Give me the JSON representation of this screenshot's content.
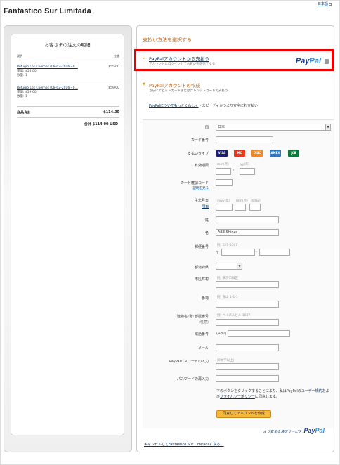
{
  "header": {
    "merchant": "Fantastico Sur Limitada",
    "language": "日本語"
  },
  "summary": {
    "title": "お客さまの注文の明細",
    "col_desc": "説明",
    "col_amount": "金額",
    "items": [
      {
        "name": "Refugio Los Cuernos (08-02-2016 - 0...",
        "amount": "$55.00",
        "price": "単価: $55.00",
        "qty": "数量: 1"
      },
      {
        "name": "Refugio Los Cuernos (08-02-2016 - 0...",
        "amount": "$59.00",
        "price": "単価: $59.00",
        "qty": "数量: 1"
      }
    ],
    "subtotal_label": "商品合計",
    "subtotal": "$114.00",
    "total": "合計 $114.00 USD"
  },
  "payment": {
    "select_title": "支払い方法を選択する",
    "paypal_option": "PayPalアカウントから支払う",
    "paypal_sub": "アカウントにログインしてお買い物を完了する",
    "create_title": "PayPalアカウントの作成",
    "create_sub": "さらにデビットカードまたはクレジットカードで支払う",
    "learn_link": "PayPalについてもっとくわしく",
    "learn_rest": " - スピーディかつより安全にお支払い"
  },
  "form": {
    "country_label": "国",
    "country_value": "日本",
    "card_label": "カード番号",
    "type_label": "支払いタイプ",
    "cards": [
      "VISA",
      "MC",
      "DISC",
      "AMEX",
      "JCB"
    ],
    "expiry_label": "有効期限",
    "mm_hint": "mm(月)",
    "yy_hint": "yy(年)",
    "slash": "/",
    "cvv_label": "カード確認コード",
    "cvv_link": "説明を見る",
    "dob_label": "生年月日",
    "dob_link": "理由",
    "dob_yyyy": "yyyy(年)",
    "dob_mm": "mm(月)",
    "dob_dd": "dd(日)",
    "last_label": "姓",
    "first_label": "名",
    "first_value": "ABE Shinzo",
    "zip_label": "郵便番号",
    "zip_hint": "例: 123-4567",
    "zip_prefix": "〒",
    "zip_dash": "-",
    "pref_label": "都道府県",
    "city_label": "市区町村",
    "city_hint": "例: 横浜市緑区",
    "addr_label": "番地",
    "addr_hint": "例: 青山 1-1-1",
    "bldg_label": "建物名･階･部屋番号",
    "bldg_sub": "(任意)",
    "bldg_hint": "例: ペイパルビル 1037",
    "phone_label": "電話番号",
    "phone_prefix": "(+81)",
    "email_label": "メール",
    "pw_label": "PayPalパスワードの入力",
    "pw_hint": "(8文字以上)",
    "pw2_label": "パスワードの再入力"
  },
  "terms": {
    "prefix": "下のボタンをクリックすることにより、私はPayPalの",
    "ua": "ユーザー規約",
    "mid": "および",
    "privacy": "プライバシーポリシー",
    "suffix": "に同意します。"
  },
  "button": "同意してアカウントを作成",
  "secure_text": "より安全な決済サービス",
  "cancel": "キャンセルしてFantastico Sur Limitadaに戻る。"
}
